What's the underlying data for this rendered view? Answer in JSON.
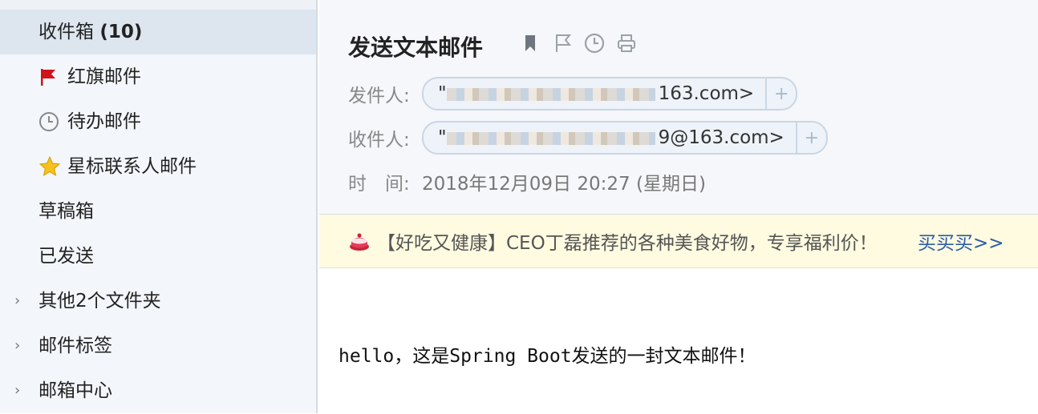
{
  "sidebar": {
    "items": [
      {
        "label": "收件箱",
        "count": "(10)"
      },
      {
        "label": "红旗邮件",
        "icon": "red-flag-icon"
      },
      {
        "label": "待办邮件",
        "icon": "clock-icon"
      },
      {
        "label": "星标联系人邮件",
        "icon": "star-icon"
      },
      {
        "label": "草稿箱"
      },
      {
        "label": "已发送"
      },
      {
        "label": "其他2个文件夹"
      },
      {
        "label": "邮件标签"
      },
      {
        "label": "邮箱中心"
      }
    ]
  },
  "email": {
    "subject": "发送文本邮件",
    "from_label": "发件人:",
    "from_addr_prefix": "\"",
    "from_addr_suffix": "163.com>",
    "to_label": "收件人:",
    "to_addr_prefix": "\"",
    "to_addr_suffix": "9@163.com>",
    "time_label": "时　间:",
    "time_value": "2018年12月09日 20:27 (星期日)",
    "plus": "+",
    "body": "hello，这是Spring Boot发送的一封文本邮件！"
  },
  "ad": {
    "text": "【好吃又健康】CEO丁磊推荐的各种美食好物，专享福利价！",
    "link": "买买买>>"
  },
  "colors": {
    "sidebar_bg": "#f3f6fa",
    "active_bg": "#dde6ef",
    "link": "#2a5ca8",
    "flag": "#d0121b",
    "star": "#f2b400"
  }
}
